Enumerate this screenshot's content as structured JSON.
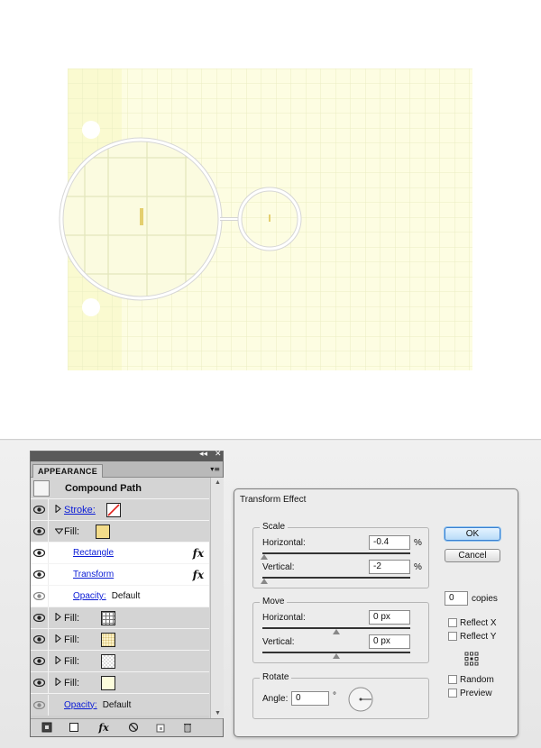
{
  "appearance": {
    "tab_label": "APPEARANCE",
    "collapse_glyph": "◂◂",
    "close_glyph": "✕",
    "menu_glyph": "▾≡",
    "object_type": "Compound Path",
    "rows": [
      {
        "label": "Stroke:",
        "kind": "stroke",
        "expanded": false
      },
      {
        "label": "Fill:",
        "kind": "fill-yellow",
        "expanded": true
      },
      {
        "label": "Rectangle",
        "kind": "effect"
      },
      {
        "label": "Transform",
        "kind": "effect"
      },
      {
        "label": "Opacity:",
        "value": "Default",
        "kind": "opacity"
      },
      {
        "label": "Fill:",
        "kind": "fill-grid"
      },
      {
        "label": "Fill:",
        "kind": "fill-dots"
      },
      {
        "label": "Fill:",
        "kind": "fill-check"
      },
      {
        "label": "Fill:",
        "kind": "fill-plain"
      },
      {
        "label": "Opacity:",
        "value": "Default",
        "kind": "opacity"
      }
    ],
    "fx_glyph": "fx",
    "bottom_icons": [
      "add-new-stroke-icon",
      "add-new-fill-icon",
      "add-new-effect-icon",
      "clear-appearance-icon",
      "duplicate-item-icon",
      "delete-item-icon"
    ]
  },
  "dialog": {
    "title": "Transform Effect",
    "scale": {
      "label": "Scale",
      "horizontal_label": "Horizontal:",
      "horizontal_value": "-0.4",
      "vertical_label": "Vertical:",
      "vertical_value": "-2",
      "unit": "%"
    },
    "move": {
      "label": "Move",
      "horizontal_label": "Horizontal:",
      "horizontal_value": "0 px",
      "vertical_label": "Vertical:",
      "vertical_value": "0 px"
    },
    "rotate": {
      "label": "Rotate",
      "angle_label": "Angle:",
      "angle_value": "0",
      "degree": "°"
    },
    "ok_label": "OK",
    "cancel_label": "Cancel",
    "copies_value": "0",
    "copies_label": "copies",
    "reflect_x": "Reflect X",
    "reflect_y": "Reflect Y",
    "random": "Random",
    "preview": "Preview"
  },
  "colors": {
    "paper": "#fdfde0",
    "paper_edge": "#f9f9cf",
    "grid": "#eef0c8",
    "mark": "#e8d47a",
    "link": "#0a1bd6"
  }
}
